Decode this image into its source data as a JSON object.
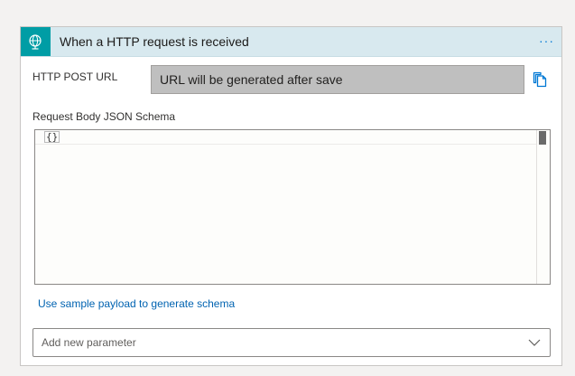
{
  "trigger": {
    "icon": "http-globe-icon",
    "accent_color": "#009da5",
    "header_color": "#d8e9ef",
    "title": "When a HTTP request is received",
    "more_label": "···"
  },
  "post_url": {
    "label": "HTTP POST URL",
    "value": "URL will be generated after save",
    "copy_icon": "copy-icon"
  },
  "schema": {
    "label": "Request Body JSON Schema",
    "content": "{}"
  },
  "sample_link": "Use sample payload to generate schema",
  "add_parameter": {
    "placeholder": "Add new parameter",
    "icon": "chevron-down-icon"
  }
}
